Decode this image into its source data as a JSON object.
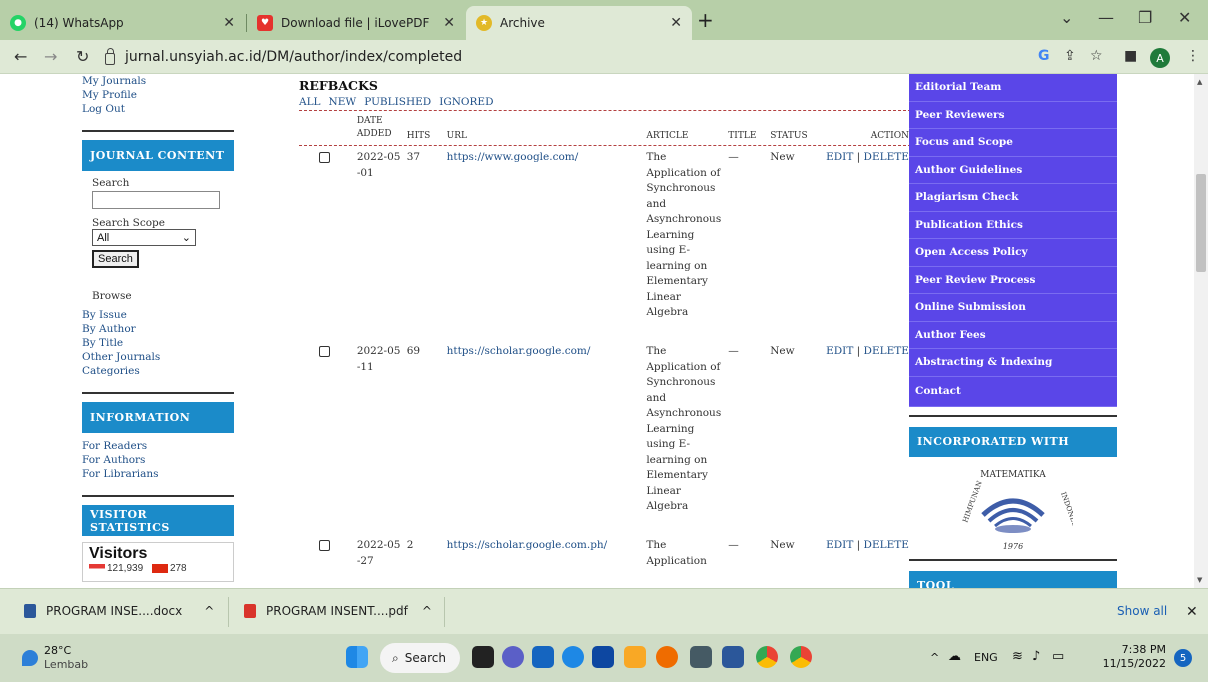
{
  "browser": {
    "tabs": [
      {
        "title": "(14) WhatsApp"
      },
      {
        "title": "Download file | iLovePDF"
      },
      {
        "title": "Archive"
      }
    ],
    "url": "jurnal.unsyiah.ac.id/DM/author/index/completed",
    "avatar_letter": "A"
  },
  "left": {
    "user_links": [
      "My Journals",
      "My Profile",
      "Log Out"
    ],
    "journal_content_title": "JOURNAL CONTENT",
    "search_label": "Search",
    "search_scope_label": "Search Scope",
    "scope_selected": "All",
    "search_button": "Search",
    "browse_label": "Browse",
    "browse_links": [
      "By Issue",
      "By Author",
      "By Title",
      "Other Journals",
      "Categories"
    ],
    "information_title": "INFORMATION",
    "info_links": [
      "For Readers",
      "For Authors",
      "For Librarians"
    ],
    "visitor_title": "VISITOR STATISTICS",
    "visitors_heading": "Visitors",
    "visitor_count_1": "121,939",
    "visitor_count_2": "278"
  },
  "main": {
    "heading": "REFBACKS",
    "filters": [
      "ALL",
      "NEW",
      "PUBLISHED",
      "IGNORED"
    ],
    "columns": {
      "date_added": "DATE ADDED",
      "hits": "HITS",
      "url": "URL",
      "article": "ARTICLE",
      "title": "TITLE",
      "status": "STATUS",
      "action": "ACTION"
    },
    "rows": [
      {
        "date": "2022-05-01",
        "hits": "37",
        "url": "https://www.google.com/",
        "article": "The Application of Synchronous and Asynchronous Learning using E-learning on Elementary Linear Algebra",
        "title": "—",
        "status": "New",
        "edit": "EDIT",
        "delete": "DELETE"
      },
      {
        "date": "2022-05-11",
        "hits": "69",
        "url": "https://scholar.google.com/",
        "article": "The Application of Synchronous and Asynchronous Learning using E-learning on Elementary Linear Algebra",
        "title": "—",
        "status": "New",
        "edit": "EDIT",
        "delete": "DELETE"
      },
      {
        "date": "2022-05-27",
        "hits": "2",
        "url": "https://scholar.google.com.ph/",
        "article": "The Application",
        "title": "—",
        "status": "New",
        "edit": "EDIT",
        "delete": "DELETE"
      }
    ]
  },
  "right": {
    "nav": [
      "Editorial Team",
      "Peer Reviewers",
      "Focus and Scope",
      "Author Guidelines",
      "Plagiarism Check",
      "Publication Ethics",
      "Open Access Policy",
      "Peer Review Process",
      "Online Submission",
      "Author Fees",
      "Abstracting & Indexing",
      "Contact"
    ],
    "incorporated_title": "INCORPORATED WITH",
    "tool_title": "TOOL",
    "logo_text_top": "MATEMATIKA",
    "logo_text_left": "HIMPUNAN",
    "logo_text_right": "INDONESIA",
    "logo_year": "1976"
  },
  "downloads": {
    "items": [
      "PROGRAM INSE....docx",
      "PROGRAM INSENT....pdf"
    ],
    "show_all": "Show all"
  },
  "taskbar": {
    "temp": "28°C",
    "location": "Lembab",
    "search": "Search",
    "lang": "ENG",
    "time": "7:38 PM",
    "date": "11/15/2022",
    "notif_count": "5"
  },
  "colors": {
    "sidebar_blue": "#1b8bc9",
    "right_nav": "#5a46e8",
    "link": "#1f4f87"
  }
}
